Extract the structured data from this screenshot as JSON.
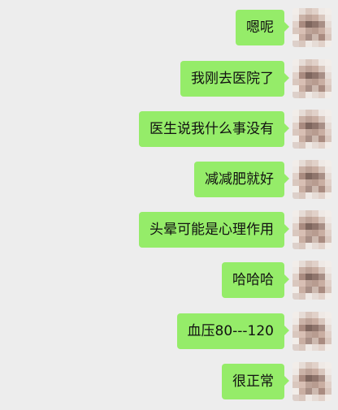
{
  "messages": [
    {
      "text": "嗯呢"
    },
    {
      "text": "我刚去医院了"
    },
    {
      "text": "医生说我什么事没有"
    },
    {
      "text": "减减肥就好"
    },
    {
      "text": "头晕可能是心理作用"
    },
    {
      "text": "哈哈哈"
    },
    {
      "text": "血压80---120"
    },
    {
      "text": "很正常"
    }
  ],
  "colors": {
    "background": "#ededed",
    "bubble": "#95ec69",
    "text": "#111111"
  }
}
